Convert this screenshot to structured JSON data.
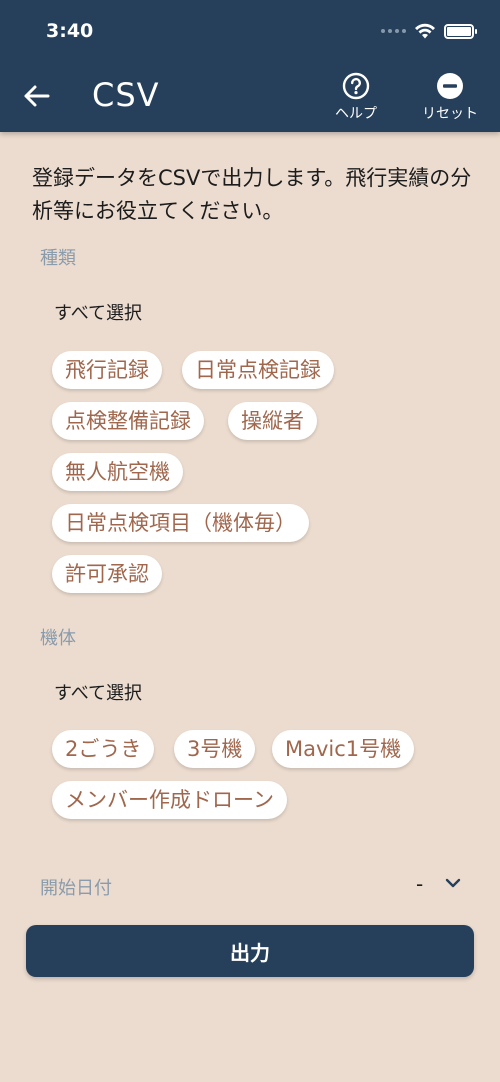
{
  "status_bar": {
    "time": "3:40"
  },
  "header": {
    "title": "CSV",
    "help_label": "ヘルプ",
    "reset_label": "リセット"
  },
  "intro": "登録データをCSVで出力します。飛行実績の分析等にお役立てください。",
  "type_section": {
    "label": "種類",
    "select_all": "すべて選択",
    "chips": [
      "飛行記録",
      "日常点検記録",
      "点検整備記録",
      "操縦者",
      "無人航空機",
      "日常点検項目（機体毎）",
      "許可承認"
    ]
  },
  "aircraft_section": {
    "label": "機体",
    "select_all": "すべて選択",
    "chips": [
      "2ごうき",
      "3号機",
      "Mavic1号機",
      "メンバー作成ドローン"
    ]
  },
  "start_date": {
    "label": "開始日付",
    "value": "-"
  },
  "export_button": "出力",
  "colors": {
    "header_bg": "#263f5b",
    "page_bg": "#ecdccf",
    "chip_text": "#a0674d",
    "section_label": "#8a9bab"
  }
}
